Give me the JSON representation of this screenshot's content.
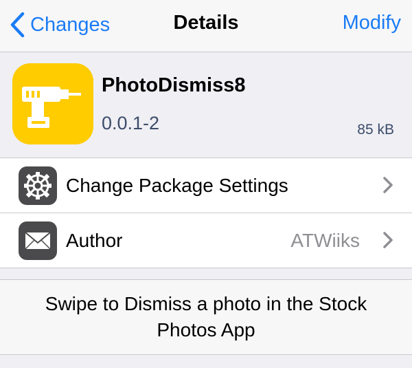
{
  "nav": {
    "back_label": "Changes",
    "title": "Details",
    "right_label": "Modify"
  },
  "package": {
    "name": "PhotoDismiss8",
    "version": "0.0.1-2",
    "size": "85 kB",
    "icon": "drill-icon",
    "icon_bg": "#ffcc00"
  },
  "rows": [
    {
      "label": "Change Package Settings",
      "icon": "gear-icon",
      "value": ""
    },
    {
      "label": "Author",
      "icon": "mail-icon",
      "value": "ATWiiks"
    }
  ],
  "description": "Swipe to Dismiss a photo in the Stock Photos App",
  "colors": {
    "accent": "#1a7cf5",
    "secondary_text": "#8e8e93",
    "version_text": "#3c4c69"
  }
}
